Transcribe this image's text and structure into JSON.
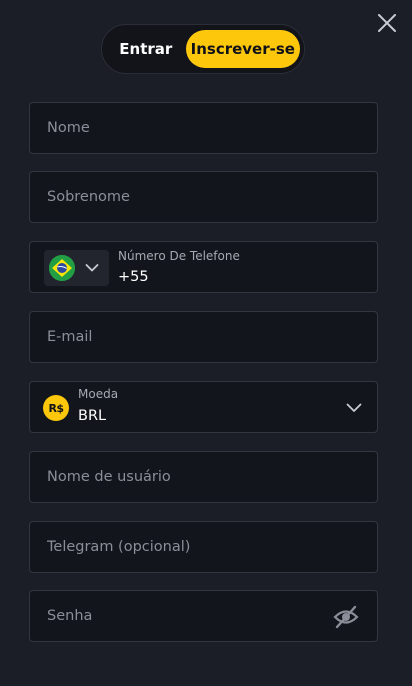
{
  "tabs": {
    "login_label": "Entrar",
    "register_label": "Inscrever-se"
  },
  "form": {
    "first_name": {
      "placeholder": "Nome"
    },
    "last_name": {
      "placeholder": "Sobrenome"
    },
    "phone": {
      "label": "Número De Telefone",
      "value": "+55",
      "country_flag": "brazil-flag-icon"
    },
    "email": {
      "placeholder": "E-mail"
    },
    "currency": {
      "label": "Moeda",
      "value": "BRL",
      "symbol": "R$"
    },
    "username": {
      "placeholder": "Nome de usuário"
    },
    "telegram": {
      "placeholder": "Telegram (opcional)"
    },
    "password": {
      "placeholder": "Senha"
    }
  },
  "colors": {
    "background": "#1c1e27",
    "accent": "#fdc70c",
    "field_bg": "#13151c",
    "field_border": "#33363f",
    "placeholder": "#8b8e98"
  }
}
